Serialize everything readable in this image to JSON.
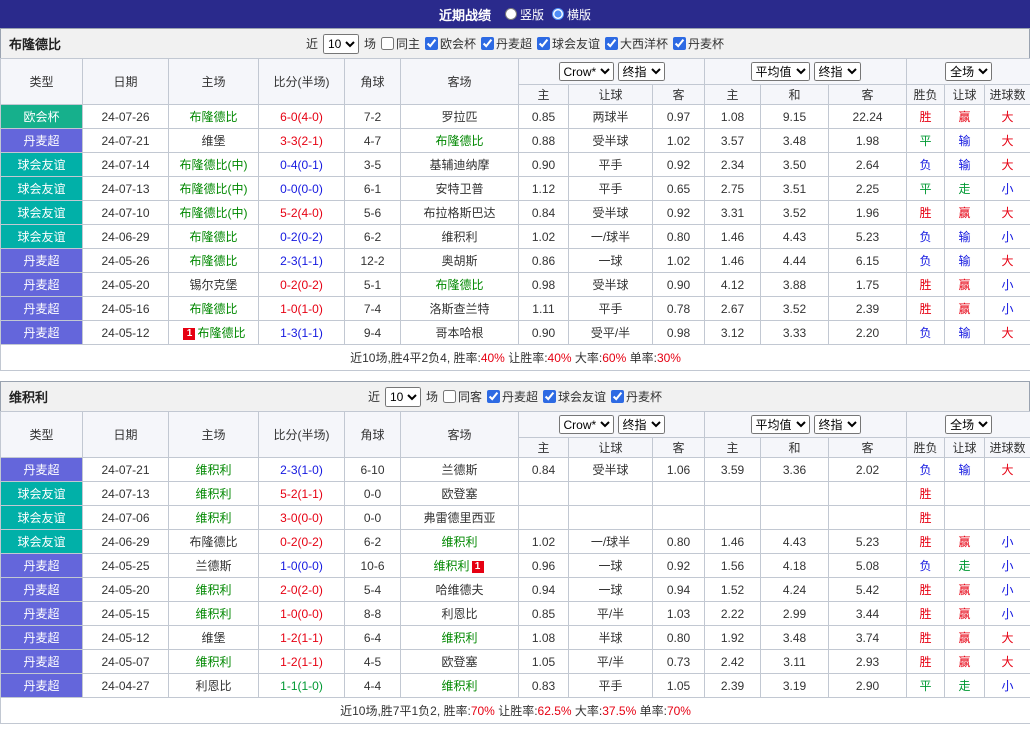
{
  "topbar": {
    "title": "近期战绩",
    "radio_vertical": "竖版",
    "radio_horizontal": "横版",
    "selected_layout": "横版"
  },
  "selects": {
    "book": "Crow*",
    "final1": "终指",
    "avg": "平均值",
    "final2": "终指",
    "scope": "全场"
  },
  "columns": {
    "base": [
      "类型",
      "日期",
      "主场",
      "比分(半场)",
      "角球",
      "客场"
    ],
    "sub": [
      "主",
      "让球",
      "客",
      "主",
      "和",
      "客",
      "胜负",
      "让球",
      "进球数"
    ]
  },
  "type_colors": {
    "欧会杯": "#16b08c",
    "丹麦超": "#6466db",
    "球会友谊": "#01b0a8"
  },
  "text_colors": {
    "red": "#e60012",
    "blue": "#1418e0",
    "green": "#009933",
    "focal": "#008800",
    "black": "#333333"
  },
  "tables": [
    {
      "team": "布隆德比",
      "filter": {
        "near": "近",
        "count": "10",
        "games": "场",
        "same": "同主",
        "same_checked": false,
        "leagues": [
          {
            "label": "欧会杯",
            "checked": true
          },
          {
            "label": "丹麦超",
            "checked": true
          },
          {
            "label": "球会友谊",
            "checked": true
          },
          {
            "label": "大西洋杯",
            "checked": true
          },
          {
            "label": "丹麦杯",
            "checked": true
          }
        ]
      },
      "rows": [
        {
          "type": "欧会杯",
          "date": "24-07-26",
          "home": "布隆德比",
          "homeFocal": true,
          "score": "6-0(4-0)",
          "scoreColor": "red",
          "corner": "7-2",
          "away": "罗拉匹",
          "awayFocal": false,
          "odds": [
            "0.85",
            "两球半",
            "0.97"
          ],
          "avg": [
            "1.08",
            "9.15",
            "22.24"
          ],
          "res": [
            [
              "胜",
              "red"
            ],
            [
              "赢",
              "red"
            ],
            [
              "大",
              "red"
            ]
          ]
        },
        {
          "type": "丹麦超",
          "date": "24-07-21",
          "home": "维堡",
          "homeFocal": false,
          "score": "3-3(2-1)",
          "scoreColor": "red",
          "corner": "4-7",
          "away": "布隆德比",
          "awayFocal": true,
          "odds": [
            "0.88",
            "受半球",
            "1.02"
          ],
          "avg": [
            "3.57",
            "3.48",
            "1.98"
          ],
          "res": [
            [
              "平",
              "green"
            ],
            [
              "输",
              "blue"
            ],
            [
              "大",
              "red"
            ]
          ]
        },
        {
          "type": "球会友谊",
          "date": "24-07-14",
          "home": "布隆德比(中)",
          "homeFocal": true,
          "score": "0-4(0-1)",
          "scoreColor": "blue",
          "corner": "3-5",
          "away": "基辅迪纳摩",
          "awayFocal": false,
          "odds": [
            "0.90",
            "平手",
            "0.92"
          ],
          "avg": [
            "2.34",
            "3.50",
            "2.64"
          ],
          "res": [
            [
              "负",
              "blue"
            ],
            [
              "输",
              "blue"
            ],
            [
              "大",
              "red"
            ]
          ]
        },
        {
          "type": "球会友谊",
          "date": "24-07-13",
          "home": "布隆德比(中)",
          "homeFocal": true,
          "score": "0-0(0-0)",
          "scoreColor": "blue",
          "corner": "6-1",
          "away": "安特卫普",
          "awayFocal": false,
          "odds": [
            "1.12",
            "平手",
            "0.65"
          ],
          "avg": [
            "2.75",
            "3.51",
            "2.25"
          ],
          "res": [
            [
              "平",
              "green"
            ],
            [
              "走",
              "green"
            ],
            [
              "小",
              "blue"
            ]
          ]
        },
        {
          "type": "球会友谊",
          "date": "24-07-10",
          "home": "布隆德比(中)",
          "homeFocal": true,
          "score": "5-2(4-0)",
          "scoreColor": "red",
          "corner": "5-6",
          "away": "布拉格斯巴达",
          "awayFocal": false,
          "odds": [
            "0.84",
            "受半球",
            "0.92"
          ],
          "avg": [
            "3.31",
            "3.52",
            "1.96"
          ],
          "res": [
            [
              "胜",
              "red"
            ],
            [
              "赢",
              "red"
            ],
            [
              "大",
              "red"
            ]
          ]
        },
        {
          "type": "球会友谊",
          "date": "24-06-29",
          "home": "布隆德比",
          "homeFocal": true,
          "score": "0-2(0-2)",
          "scoreColor": "blue",
          "corner": "6-2",
          "away": "维积利",
          "awayFocal": false,
          "odds": [
            "1.02",
            "一/球半",
            "0.80"
          ],
          "avg": [
            "1.46",
            "4.43",
            "5.23"
          ],
          "res": [
            [
              "负",
              "blue"
            ],
            [
              "输",
              "blue"
            ],
            [
              "小",
              "blue"
            ]
          ]
        },
        {
          "type": "丹麦超",
          "date": "24-05-26",
          "home": "布隆德比",
          "homeFocal": true,
          "score": "2-3(1-1)",
          "scoreColor": "blue",
          "corner": "12-2",
          "away": "奥胡斯",
          "awayFocal": false,
          "odds": [
            "0.86",
            "一球",
            "1.02"
          ],
          "avg": [
            "1.46",
            "4.44",
            "6.15"
          ],
          "res": [
            [
              "负",
              "blue"
            ],
            [
              "输",
              "blue"
            ],
            [
              "大",
              "red"
            ]
          ]
        },
        {
          "type": "丹麦超",
          "date": "24-05-20",
          "home": "锡尔克堡",
          "homeFocal": false,
          "score": "0-2(0-2)",
          "scoreColor": "red",
          "corner": "5-1",
          "away": "布隆德比",
          "awayFocal": true,
          "odds": [
            "0.98",
            "受半球",
            "0.90"
          ],
          "avg": [
            "4.12",
            "3.88",
            "1.75"
          ],
          "res": [
            [
              "胜",
              "red"
            ],
            [
              "赢",
              "red"
            ],
            [
              "小",
              "blue"
            ]
          ]
        },
        {
          "type": "丹麦超",
          "date": "24-05-16",
          "home": "布隆德比",
          "homeFocal": true,
          "score": "1-0(1-0)",
          "scoreColor": "red",
          "corner": "7-4",
          "away": "洛斯查兰特",
          "awayFocal": false,
          "odds": [
            "1.11",
            "平手",
            "0.78"
          ],
          "avg": [
            "2.67",
            "3.52",
            "2.39"
          ],
          "res": [
            [
              "胜",
              "red"
            ],
            [
              "赢",
              "red"
            ],
            [
              "小",
              "blue"
            ]
          ]
        },
        {
          "type": "丹麦超",
          "date": "24-05-12",
          "home": "布隆德比",
          "homeFocal": true,
          "homeBadge": {
            "text": "1",
            "pos": "before"
          },
          "score": "1-3(1-1)",
          "scoreColor": "blue",
          "corner": "9-4",
          "away": "哥本哈根",
          "awayFocal": false,
          "odds": [
            "0.90",
            "受平/半",
            "0.98"
          ],
          "avg": [
            "3.12",
            "3.33",
            "2.20"
          ],
          "res": [
            [
              "负",
              "blue"
            ],
            [
              "输",
              "blue"
            ],
            [
              "大",
              "red"
            ]
          ]
        }
      ],
      "summary": {
        "prefix": "近10场,胜4平2负4,",
        "stats": [
          [
            "胜率:",
            "40%"
          ],
          [
            "让胜率:",
            "40%"
          ],
          [
            "大率:",
            "60%"
          ],
          [
            "单率:",
            "30%"
          ]
        ]
      }
    },
    {
      "team": "维积利",
      "filter": {
        "near": "近",
        "count": "10",
        "games": "场",
        "same": "同客",
        "same_checked": false,
        "leagues": [
          {
            "label": "丹麦超",
            "checked": true
          },
          {
            "label": "球会友谊",
            "checked": true
          },
          {
            "label": "丹麦杯",
            "checked": true
          }
        ]
      },
      "rows": [
        {
          "type": "丹麦超",
          "date": "24-07-21",
          "home": "维积利",
          "homeFocal": true,
          "score": "2-3(1-0)",
          "scoreColor": "blue",
          "corner": "6-10",
          "away": "兰德斯",
          "awayFocal": false,
          "odds": [
            "0.84",
            "受半球",
            "1.06"
          ],
          "avg": [
            "3.59",
            "3.36",
            "2.02"
          ],
          "res": [
            [
              "负",
              "blue"
            ],
            [
              "输",
              "blue"
            ],
            [
              "大",
              "red"
            ]
          ]
        },
        {
          "type": "球会友谊",
          "date": "24-07-13",
          "home": "维积利",
          "homeFocal": true,
          "score": "5-2(1-1)",
          "scoreColor": "red",
          "corner": "0-0",
          "away": "欧登塞",
          "awayFocal": false,
          "odds": [
            "",
            "",
            ""
          ],
          "avg": [
            "",
            "",
            ""
          ],
          "res": [
            [
              "胜",
              "red"
            ],
            [
              "",
              ""
            ],
            [
              "",
              ""
            ]
          ]
        },
        {
          "type": "球会友谊",
          "date": "24-07-06",
          "home": "维积利",
          "homeFocal": true,
          "score": "3-0(0-0)",
          "scoreColor": "red",
          "corner": "0-0",
          "away": "弗雷德里西亚",
          "awayFocal": false,
          "odds": [
            "",
            "",
            ""
          ],
          "avg": [
            "",
            "",
            ""
          ],
          "res": [
            [
              "胜",
              "red"
            ],
            [
              "",
              ""
            ],
            [
              "",
              ""
            ]
          ]
        },
        {
          "type": "球会友谊",
          "date": "24-06-29",
          "home": "布隆德比",
          "homeFocal": false,
          "score": "0-2(0-2)",
          "scoreColor": "red",
          "corner": "6-2",
          "away": "维积利",
          "awayFocal": true,
          "odds": [
            "1.02",
            "一/球半",
            "0.80"
          ],
          "avg": [
            "1.46",
            "4.43",
            "5.23"
          ],
          "res": [
            [
              "胜",
              "red"
            ],
            [
              "赢",
              "red"
            ],
            [
              "小",
              "blue"
            ]
          ]
        },
        {
          "type": "丹麦超",
          "date": "24-05-25",
          "home": "兰德斯",
          "homeFocal": false,
          "score": "1-0(0-0)",
          "scoreColor": "blue",
          "corner": "10-6",
          "away": "维积利",
          "awayFocal": true,
          "awayBadge": {
            "text": "1",
            "pos": "after"
          },
          "odds": [
            "0.96",
            "一球",
            "0.92"
          ],
          "avg": [
            "1.56",
            "4.18",
            "5.08"
          ],
          "res": [
            [
              "负",
              "blue"
            ],
            [
              "走",
              "green"
            ],
            [
              "小",
              "blue"
            ]
          ]
        },
        {
          "type": "丹麦超",
          "date": "24-05-20",
          "home": "维积利",
          "homeFocal": true,
          "score": "2-0(2-0)",
          "scoreColor": "red",
          "corner": "5-4",
          "away": "哈维德夫",
          "awayFocal": false,
          "odds": [
            "0.94",
            "一球",
            "0.94"
          ],
          "avg": [
            "1.52",
            "4.24",
            "5.42"
          ],
          "res": [
            [
              "胜",
              "red"
            ],
            [
              "赢",
              "red"
            ],
            [
              "小",
              "blue"
            ]
          ]
        },
        {
          "type": "丹麦超",
          "date": "24-05-15",
          "home": "维积利",
          "homeFocal": true,
          "score": "1-0(0-0)",
          "scoreColor": "red",
          "corner": "8-8",
          "away": "利恩比",
          "awayFocal": false,
          "odds": [
            "0.85",
            "平/半",
            "1.03"
          ],
          "avg": [
            "2.22",
            "2.99",
            "3.44"
          ],
          "res": [
            [
              "胜",
              "red"
            ],
            [
              "赢",
              "red"
            ],
            [
              "小",
              "blue"
            ]
          ]
        },
        {
          "type": "丹麦超",
          "date": "24-05-12",
          "home": "维堡",
          "homeFocal": false,
          "score": "1-2(1-1)",
          "scoreColor": "red",
          "corner": "6-4",
          "away": "维积利",
          "awayFocal": true,
          "odds": [
            "1.08",
            "半球",
            "0.80"
          ],
          "avg": [
            "1.92",
            "3.48",
            "3.74"
          ],
          "res": [
            [
              "胜",
              "red"
            ],
            [
              "赢",
              "red"
            ],
            [
              "大",
              "red"
            ]
          ]
        },
        {
          "type": "丹麦超",
          "date": "24-05-07",
          "home": "维积利",
          "homeFocal": true,
          "score": "1-2(1-1)",
          "scoreColor": "red",
          "corner": "4-5",
          "away": "欧登塞",
          "awayFocal": false,
          "odds": [
            "1.05",
            "平/半",
            "0.73"
          ],
          "avg": [
            "2.42",
            "3.11",
            "2.93"
          ],
          "res": [
            [
              "胜",
              "red"
            ],
            [
              "赢",
              "red"
            ],
            [
              "大",
              "red"
            ]
          ]
        },
        {
          "type": "丹麦超",
          "date": "24-04-27",
          "home": "利恩比",
          "homeFocal": false,
          "score": "1-1(1-0)",
          "scoreColor": "green",
          "corner": "4-4",
          "away": "维积利",
          "awayFocal": true,
          "odds": [
            "0.83",
            "平手",
            "1.05"
          ],
          "avg": [
            "2.39",
            "3.19",
            "2.90"
          ],
          "res": [
            [
              "平",
              "green"
            ],
            [
              "走",
              "green"
            ],
            [
              "小",
              "blue"
            ]
          ]
        }
      ],
      "summary": {
        "prefix": "近10场,胜7平1负2,",
        "stats": [
          [
            "胜率:",
            "70%"
          ],
          [
            "让胜率:",
            "62.5%"
          ],
          [
            "大率:",
            "37.5%"
          ],
          [
            "单率:",
            "70%"
          ]
        ]
      }
    }
  ]
}
